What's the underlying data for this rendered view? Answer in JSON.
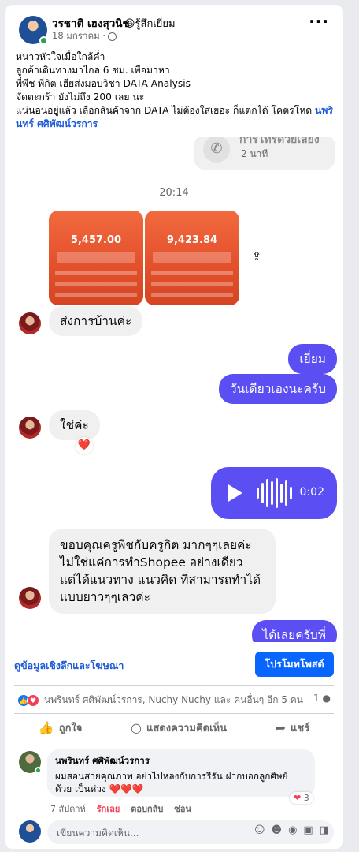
{
  "post": {
    "author": "วรชาติ เฮงสุวนิช",
    "feeling": "😆รู้สึกเยี่ยม",
    "date": "18 มกราคม ·",
    "lines": [
      "หนาวหัวใจเมื่อใกล้ค่ำ",
      "ลูกค้าเดินทางมาไกล 6 ชม. เพื่อมาหา",
      "พี่พีช พี่กิต เฮียส่งมอบวิชา DATA Analysis",
      "จัดตะกร้า ยังไม่ถึง 200 เลย นะ",
      "แน่นอนอยู่แล้ว เลือกสินค้าจาก DATA ไม่ต้องใส่เยอะ ก็แตกได้ โคตรโหด"
    ],
    "tag": "นพรินทร์ ศศิพัฒน์วรการ",
    "more_icon": "ellipsis-icon"
  },
  "chat": {
    "call_title": "การโทรด้วยเสียง",
    "call_time": "2 นาที",
    "time_divider": "20:14",
    "images": [
      {
        "amount": "5,457.00"
      },
      {
        "amount": "9,423.84"
      }
    ],
    "messages": {
      "in1": "ส่งการบ้านค่ะ",
      "out1": "เยี่ยม",
      "out2": "วันเดียวเองนะครับ",
      "in2": "ใช่ค่ะ",
      "in2_react": "❤️",
      "audio_duration": "0:02",
      "in3": [
        "ขอบคุณครูพีชกับครูกิต มากๆๆเลยค่ะ",
        "ไม่ใช่แค่การทำShopee อย่างเดียว",
        "แต่ได้แนวทาง แนวคิด ที่สามารถทำได้",
        "แบบยาวๆๆเลวค่ะ"
      ],
      "out3": "ได้เลยครับพี่"
    }
  },
  "footer": {
    "insights_link": "ดูข้อมูลเชิงลึกและโฆษณา",
    "promote_button": "โปรโมทโพสต์",
    "reactors": "นพรินทร์ ศศิพัฒน์วรการ, Nuchy Nuchy และ คนอื่นๆ อีก 5 คน",
    "comment_count": "1",
    "actions": {
      "like": "ถูกใจ",
      "comment": "แสดงความคิดเห็น",
      "share": "แชร์"
    },
    "comment": {
      "name": "นพรินทร์ ศศิพัฒน์วรการ",
      "text": "ผมสอนสายคุณภาพ อย่าไปหลงกับการรีรัน ฝากบอกลูกศิษย์ ด้วย เป็นห่วง ❤️❤️❤️",
      "react_count": "3",
      "time": "7 สัปดาห์",
      "love": "รักเลย",
      "reply": "ตอบกลับ",
      "hide": "ซ่อน"
    },
    "write_placeholder": "เขียนความคิดเห็น..."
  },
  "colors": {
    "messenger_blue": "#5b4ef2",
    "facebook_blue": "#0866ff",
    "link_blue": "#1d5bd8"
  }
}
